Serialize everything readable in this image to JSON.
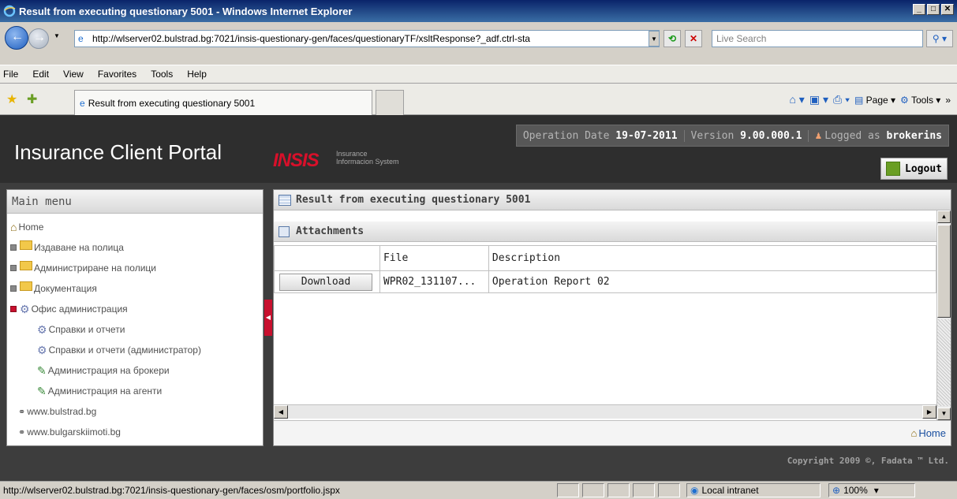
{
  "window": {
    "title": "Result from executing questionary 5001 - Windows Internet Explorer",
    "min": "_",
    "max": "□",
    "close": "✕"
  },
  "nav": {
    "address": "http://wlserver02.bulstrad.bg:7021/insis-questionary-gen/faces/questionaryTF/xsltResponse?_adf.ctrl-sta",
    "search_placeholder": "Live Search"
  },
  "menubar": [
    "File",
    "Edit",
    "View",
    "Favorites",
    "Tools",
    "Help"
  ],
  "tab": {
    "title": "Result from executing questionary 5001"
  },
  "cmdbar": {
    "page": "Page",
    "tools": "Tools"
  },
  "header": {
    "portal_title": "Insurance Client Portal",
    "logo": "INSIS",
    "logo_sub1": "Insurance",
    "logo_sub2": "Informacion System",
    "op_date_label": "Operation Date",
    "op_date": "19-07-2011",
    "version_label": "Version",
    "version": "9.00.000.1",
    "logged_label": "Logged as",
    "user": "brokerins",
    "logout": "Logout"
  },
  "sidebar": {
    "title": "Main menu",
    "items": [
      {
        "label": "Home"
      },
      {
        "label": "Издаване на полица"
      },
      {
        "label": "Администриране на полици"
      },
      {
        "label": "Документация"
      },
      {
        "label": "Офис администрация"
      },
      {
        "label": "Справки и отчети"
      },
      {
        "label": "Справки и отчети (администратор)"
      },
      {
        "label": "Администрация на брокери"
      },
      {
        "label": "Администрация на агенти"
      },
      {
        "label": "www.bulstrad.bg"
      },
      {
        "label": "www.bulgarskiimoti.bg"
      }
    ]
  },
  "main": {
    "title": "Result from executing questionary 5001",
    "attachments_title": "Attachments",
    "columns": {
      "file": "File",
      "description": "Description"
    },
    "rows": [
      {
        "button": "Download",
        "file": "WPR02_131107...",
        "description": "Operation Report 02"
      }
    ],
    "home_link": "Home"
  },
  "copyright": "Copyright 2009 ©, Fadata ™ Ltd.",
  "status": {
    "url": "http://wlserver02.bulstrad.bg:7021/insis-questionary-gen/faces/osm/portfolio.jspx",
    "zone": "Local intranet",
    "zoom": "100%"
  }
}
